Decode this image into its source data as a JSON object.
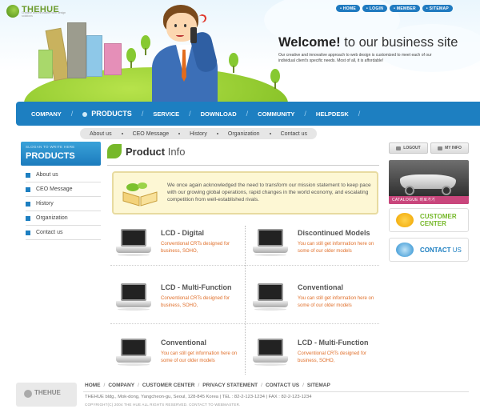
{
  "brand": {
    "logo_text": "THEHUE",
    "logo_tagline": "Creative and innovative web design solutions"
  },
  "util_nav": [
    "HOME",
    "LOGIN",
    "MEMBER",
    "SITEMAP"
  ],
  "hero": {
    "welcome_bold": "Welcome!",
    "welcome_rest": "to our business site",
    "description": "Our creative and innovative approach to web design is customized to meet each of our individual client's specific needs. Most of all, it is affordable!"
  },
  "main_nav": [
    "COMPANY",
    "PRODUCTS",
    "SERVICE",
    "DOWNLOAD",
    "COMMUNITY",
    "HELPDESK"
  ],
  "sub_nav": [
    "About us",
    "CEO Message",
    "History",
    "Organization",
    "Contact us"
  ],
  "sidebar": {
    "slogan": "SLOGAN TO WRITE HERE",
    "title": "PRODUCTS",
    "items": [
      "About us",
      "CEO Message",
      "History",
      "Organization",
      "Contact us"
    ]
  },
  "content": {
    "title_bold": "Product",
    "title_rest": "Info",
    "intro": "We once again acknowledged the need to transform our mission statement to keep pace with our growing global operations, rapid changes in the world economy, and escalating competition from well-established rivals.",
    "products": [
      {
        "title": "LCD - Digital",
        "desc": "Conventional CRTs designed for business, SOHO,"
      },
      {
        "title": "Discontinued Models",
        "desc": "You can still get information here on some of our older models"
      },
      {
        "title": "LCD - Multi-Function",
        "desc": "Conventional CRTs designed for business, SOHO,"
      },
      {
        "title": "Conventional",
        "desc": "You can still get information here on some of our older models"
      },
      {
        "title": "Conventional",
        "desc": "You can still get information here on some of our older models"
      },
      {
        "title": "LCD - Multi-Function",
        "desc": "Conventional CRTs designed for business, SOHO,"
      }
    ]
  },
  "right": {
    "logout": "LOGOUT",
    "my_info": "MY INFO",
    "catalogue": "CATALOGUE 바로가기",
    "customer_center_line1": "CUSTOMER",
    "customer_center_line2": "CENTER",
    "contact_us_bold": "CONTACT",
    "contact_us_rest": "US"
  },
  "footer": {
    "logo_text": "THEHUE",
    "links": [
      "HOME",
      "COMPANY",
      "CUSTOMER CENTER",
      "PRIVACY STATEMENT",
      "CONTACT US",
      "SITEMAP"
    ],
    "address": "THEHUE bldg., Mok-dong, Yangcheon-gu, Seoul, 128-845 Korea  |  TEL : 82-2-123-1234  |  FAX : 82-2-123-1234",
    "copyright": "COPYRIGHT(C) 2004 THE HUE ALL RIGHTS RESERVED. CONTACT TO WEBMASTER."
  },
  "colors": {
    "primary": "#1d7fc1",
    "accent_green": "#76b82a",
    "accent_orange": "#e06f2a",
    "catalogue_pink": "#c9467c"
  }
}
